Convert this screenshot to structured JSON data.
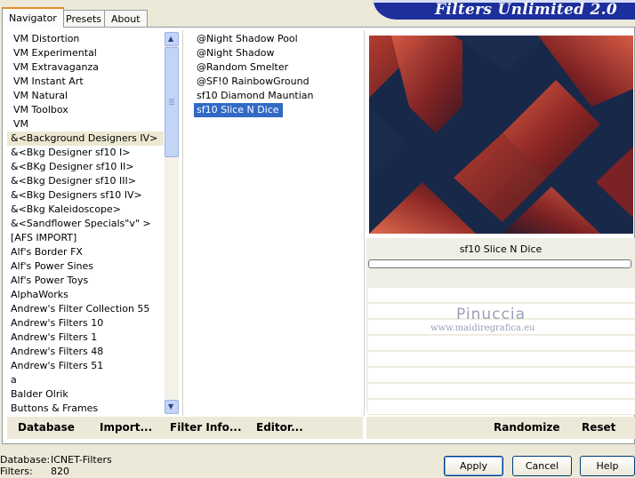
{
  "tabs": [
    "Navigator",
    "Presets",
    "About"
  ],
  "app_title": "Filters Unlimited 2.0",
  "categories": [
    "VM Distortion",
    "VM Experimental",
    "VM Extravaganza",
    "VM Instant Art",
    "VM Natural",
    "VM Toolbox",
    "VM",
    "&<Background Designers IV>",
    "&<Bkg Designer sf10 I>",
    "&<BKg Designer sf10 II>",
    "&<Bkg Designer sf10 III>",
    "&<Bkg Designers sf10 IV>",
    "&<Bkg Kaleidoscope>",
    "&<Sandflower Specials\"v\" >",
    "[AFS IMPORT]",
    "Alf's Border FX",
    "Alf's Power Sines",
    "Alf's Power Toys",
    "AlphaWorks",
    "Andrew's Filter Collection 55",
    "Andrew's Filters 10",
    "Andrew's Filters 1",
    "Andrew's Filters 48",
    "Andrew's Filters 51",
    "a",
    "Balder Olrik",
    "Buttons & Frames"
  ],
  "selected_category": "&<Background Designers IV>",
  "filters": [
    "@Night Shadow Pool",
    "@Night Shadow",
    "@Random Smelter",
    "@SF!0 RainbowGround",
    "sf10 Diamond Mauntian",
    "sf10 Slice N Dice"
  ],
  "selected_filter": "sf10 Slice N Dice",
  "filter_name_display": "sf10 Slice N Dice",
  "watermark": {
    "name": "Pinuccia",
    "site": "www.maidiregrafica.eu"
  },
  "toolbar": {
    "database": "Database",
    "import": "Import...",
    "filter_info": "Filter Info...",
    "editor": "Editor...",
    "randomize": "Randomize",
    "reset": "Reset"
  },
  "status": {
    "database_label": "Database:",
    "database_value": "ICNET-Filters",
    "filters_label": "Filters:",
    "filters_value": "820"
  },
  "buttons": {
    "apply": "Apply",
    "cancel": "Cancel",
    "help": "Help"
  },
  "colors": {
    "selection": "#316ac5",
    "banner": "#1d2f9c",
    "preview_bg": "#1a2a4e",
    "preview_red": "#c24a3a"
  }
}
